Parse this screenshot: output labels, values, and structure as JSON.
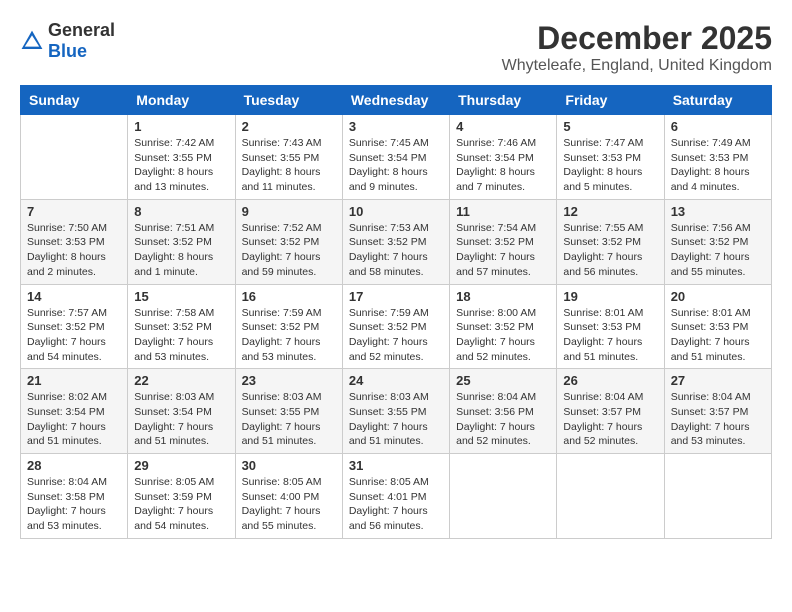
{
  "header": {
    "logo_general": "General",
    "logo_blue": "Blue",
    "title": "December 2025",
    "subtitle": "Whyteleafe, England, United Kingdom"
  },
  "calendar": {
    "columns": [
      "Sunday",
      "Monday",
      "Tuesday",
      "Wednesday",
      "Thursday",
      "Friday",
      "Saturday"
    ],
    "weeks": [
      [
        {
          "day": "",
          "info": ""
        },
        {
          "day": "1",
          "info": "Sunrise: 7:42 AM\nSunset: 3:55 PM\nDaylight: 8 hours\nand 13 minutes."
        },
        {
          "day": "2",
          "info": "Sunrise: 7:43 AM\nSunset: 3:55 PM\nDaylight: 8 hours\nand 11 minutes."
        },
        {
          "day": "3",
          "info": "Sunrise: 7:45 AM\nSunset: 3:54 PM\nDaylight: 8 hours\nand 9 minutes."
        },
        {
          "day": "4",
          "info": "Sunrise: 7:46 AM\nSunset: 3:54 PM\nDaylight: 8 hours\nand 7 minutes."
        },
        {
          "day": "5",
          "info": "Sunrise: 7:47 AM\nSunset: 3:53 PM\nDaylight: 8 hours\nand 5 minutes."
        },
        {
          "day": "6",
          "info": "Sunrise: 7:49 AM\nSunset: 3:53 PM\nDaylight: 8 hours\nand 4 minutes."
        }
      ],
      [
        {
          "day": "7",
          "info": "Sunrise: 7:50 AM\nSunset: 3:53 PM\nDaylight: 8 hours\nand 2 minutes."
        },
        {
          "day": "8",
          "info": "Sunrise: 7:51 AM\nSunset: 3:52 PM\nDaylight: 8 hours\nand 1 minute."
        },
        {
          "day": "9",
          "info": "Sunrise: 7:52 AM\nSunset: 3:52 PM\nDaylight: 7 hours\nand 59 minutes."
        },
        {
          "day": "10",
          "info": "Sunrise: 7:53 AM\nSunset: 3:52 PM\nDaylight: 7 hours\nand 58 minutes."
        },
        {
          "day": "11",
          "info": "Sunrise: 7:54 AM\nSunset: 3:52 PM\nDaylight: 7 hours\nand 57 minutes."
        },
        {
          "day": "12",
          "info": "Sunrise: 7:55 AM\nSunset: 3:52 PM\nDaylight: 7 hours\nand 56 minutes."
        },
        {
          "day": "13",
          "info": "Sunrise: 7:56 AM\nSunset: 3:52 PM\nDaylight: 7 hours\nand 55 minutes."
        }
      ],
      [
        {
          "day": "14",
          "info": "Sunrise: 7:57 AM\nSunset: 3:52 PM\nDaylight: 7 hours\nand 54 minutes."
        },
        {
          "day": "15",
          "info": "Sunrise: 7:58 AM\nSunset: 3:52 PM\nDaylight: 7 hours\nand 53 minutes."
        },
        {
          "day": "16",
          "info": "Sunrise: 7:59 AM\nSunset: 3:52 PM\nDaylight: 7 hours\nand 53 minutes."
        },
        {
          "day": "17",
          "info": "Sunrise: 7:59 AM\nSunset: 3:52 PM\nDaylight: 7 hours\nand 52 minutes."
        },
        {
          "day": "18",
          "info": "Sunrise: 8:00 AM\nSunset: 3:52 PM\nDaylight: 7 hours\nand 52 minutes."
        },
        {
          "day": "19",
          "info": "Sunrise: 8:01 AM\nSunset: 3:53 PM\nDaylight: 7 hours\nand 51 minutes."
        },
        {
          "day": "20",
          "info": "Sunrise: 8:01 AM\nSunset: 3:53 PM\nDaylight: 7 hours\nand 51 minutes."
        }
      ],
      [
        {
          "day": "21",
          "info": "Sunrise: 8:02 AM\nSunset: 3:54 PM\nDaylight: 7 hours\nand 51 minutes."
        },
        {
          "day": "22",
          "info": "Sunrise: 8:03 AM\nSunset: 3:54 PM\nDaylight: 7 hours\nand 51 minutes."
        },
        {
          "day": "23",
          "info": "Sunrise: 8:03 AM\nSunset: 3:55 PM\nDaylight: 7 hours\nand 51 minutes."
        },
        {
          "day": "24",
          "info": "Sunrise: 8:03 AM\nSunset: 3:55 PM\nDaylight: 7 hours\nand 51 minutes."
        },
        {
          "day": "25",
          "info": "Sunrise: 8:04 AM\nSunset: 3:56 PM\nDaylight: 7 hours\nand 52 minutes."
        },
        {
          "day": "26",
          "info": "Sunrise: 8:04 AM\nSunset: 3:57 PM\nDaylight: 7 hours\nand 52 minutes."
        },
        {
          "day": "27",
          "info": "Sunrise: 8:04 AM\nSunset: 3:57 PM\nDaylight: 7 hours\nand 53 minutes."
        }
      ],
      [
        {
          "day": "28",
          "info": "Sunrise: 8:04 AM\nSunset: 3:58 PM\nDaylight: 7 hours\nand 53 minutes."
        },
        {
          "day": "29",
          "info": "Sunrise: 8:05 AM\nSunset: 3:59 PM\nDaylight: 7 hours\nand 54 minutes."
        },
        {
          "day": "30",
          "info": "Sunrise: 8:05 AM\nSunset: 4:00 PM\nDaylight: 7 hours\nand 55 minutes."
        },
        {
          "day": "31",
          "info": "Sunrise: 8:05 AM\nSunset: 4:01 PM\nDaylight: 7 hours\nand 56 minutes."
        },
        {
          "day": "",
          "info": ""
        },
        {
          "day": "",
          "info": ""
        },
        {
          "day": "",
          "info": ""
        }
      ]
    ]
  }
}
